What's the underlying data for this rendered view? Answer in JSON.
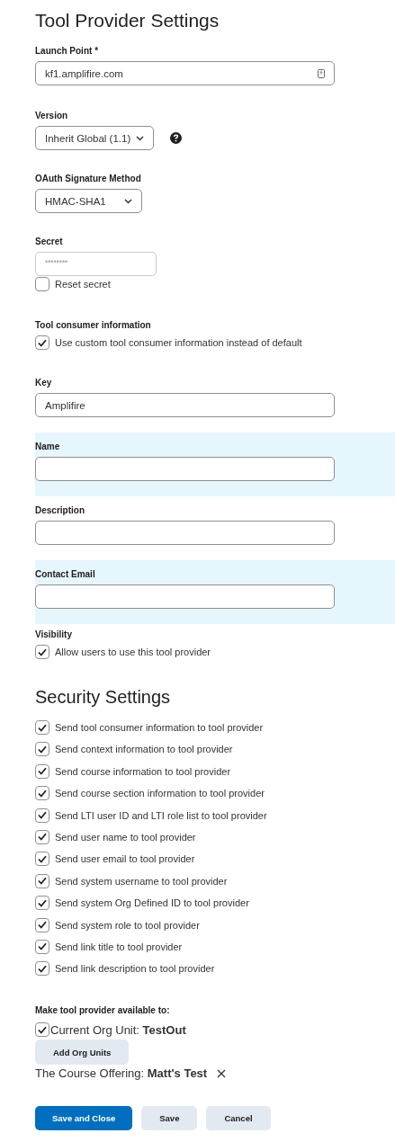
{
  "page_title": "Tool Provider Settings",
  "launch_point": {
    "label": "Launch Point",
    "required_mark": "*",
    "value": "kf1.amplifire.com"
  },
  "version": {
    "label": "Version",
    "value": "Inherit Global (1.1)"
  },
  "oauth_signature_method": {
    "label": "OAuth Signature Method",
    "value": "HMAC-SHA1"
  },
  "secret": {
    "label": "Secret",
    "placeholder": "••••••••",
    "reset_checkbox": {
      "label": "Reset secret",
      "checked": false
    }
  },
  "tool_consumer_information": {
    "label": "Tool consumer information",
    "checkbox": {
      "label": "Use custom tool consumer information instead of default",
      "checked": true
    }
  },
  "consumer_fields": [
    {
      "label": "Key",
      "value": "Amplifire",
      "highlighted": false
    },
    {
      "label": "Name",
      "highlighted": true
    },
    {
      "label": "Description",
      "highlighted": false
    },
    {
      "label": "Contact Email",
      "highlighted": true
    }
  ],
  "visibility": {
    "label": "Visibility",
    "checkbox": {
      "label": "Allow users to use this tool provider",
      "checked": true
    }
  },
  "security_settings": {
    "heading": "Security Settings",
    "options": [
      {
        "label": "Send tool consumer information to tool provider",
        "checked": true
      },
      {
        "label": "Send context information to tool provider",
        "checked": true
      },
      {
        "label": "Send course information to tool provider",
        "checked": true
      },
      {
        "label": "Send course section information to tool provider",
        "checked": true
      },
      {
        "label": "Send LTI user ID and LTI role list to tool provider",
        "checked": true
      },
      {
        "label": "Send user name to tool provider",
        "checked": true
      },
      {
        "label": "Send user email to tool provider",
        "checked": true
      },
      {
        "label": "Send system username to tool provider",
        "checked": true
      },
      {
        "label": "Send system Org Defined ID to tool provider",
        "checked": true
      },
      {
        "label": "Send system role to tool provider",
        "checked": true
      },
      {
        "label": "Send link title to tool provider",
        "checked": true
      },
      {
        "label": "Send link description to tool provider",
        "checked": true
      }
    ]
  },
  "availability": {
    "label": "Make tool provider available to:",
    "current_org_unit": {
      "label": "Current Org Unit: **TestOut**",
      "checked": true
    },
    "add_button": "Add Org Units",
    "course_offering": {
      "label": "The Course Offering: **Matt's Test**"
    }
  },
  "actions": [
    {
      "label": "Save and Close",
      "primary": true
    },
    {
      "label": "Save",
      "primary": false
    },
    {
      "label": "Cancel",
      "primary": false
    }
  ]
}
